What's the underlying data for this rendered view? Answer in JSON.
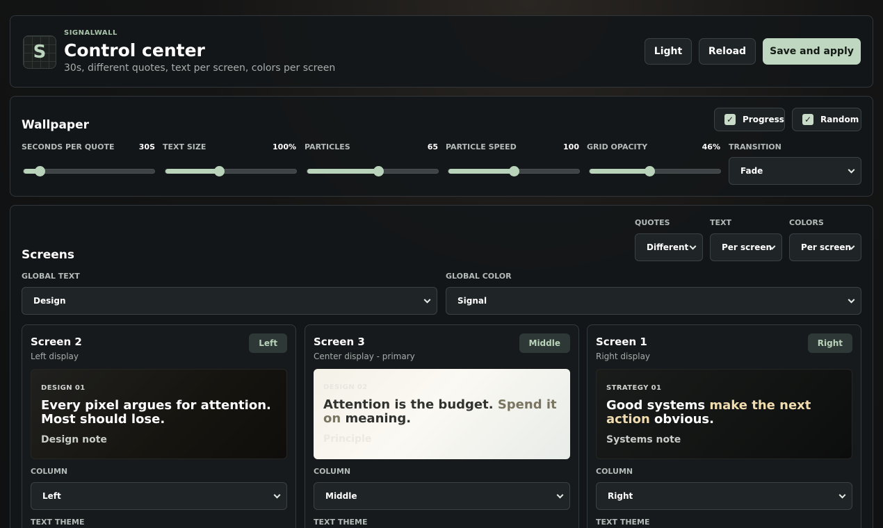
{
  "header": {
    "logo_letter": "S",
    "brand": "SIGNALWALL",
    "title": "Control center",
    "subtitle": "30s, different quotes, text per screen, colors per screen",
    "buttons": {
      "light": "Light",
      "reload": "Reload",
      "save": "Save and apply"
    }
  },
  "wallpaper": {
    "title": "Wallpaper",
    "toggles": {
      "progress": "Progress",
      "random": "Random"
    },
    "sliders": [
      {
        "label": "SECONDS PER QUOTE",
        "value_text": "30S",
        "level": 0.12
      },
      {
        "label": "TEXT SIZE",
        "value_text": "100%",
        "level": 0.41
      },
      {
        "label": "PARTICLES",
        "value_text": "65",
        "level": 0.54
      },
      {
        "label": "PARTICLE SPEED",
        "value_text": "100",
        "level": 0.5
      },
      {
        "label": "GRID OPACITY",
        "value_text": "46%",
        "level": 0.46
      }
    ],
    "transition": {
      "label": "TRANSITION",
      "value": "Fade"
    }
  },
  "screens": {
    "title": "Screens",
    "quotes": {
      "label": "QUOTES",
      "value": "Different"
    },
    "text": {
      "label": "TEXT",
      "value": "Per screen"
    },
    "colors": {
      "label": "COLORS",
      "value": "Per screen"
    },
    "global_text": {
      "label": "GLOBAL TEXT",
      "value": "Design"
    },
    "global_color": {
      "label": "GLOBAL COLOR",
      "value": "Signal"
    },
    "cards": [
      {
        "name": "Screen 2",
        "desc": "Left display",
        "badge": "Left",
        "kicker": "DESIGN 01",
        "quote": "Every pixel argues for attention. Most should lose.",
        "note": "Design note",
        "column_label": "COLUMN",
        "column_value": "Left",
        "theme_label": "TEXT THEME"
      },
      {
        "name": "Screen 3",
        "desc": "Center display - primary",
        "badge": "Middle",
        "kicker": "DESIGN 02",
        "quote_a": "Attention is the budget. ",
        "quote_b": "Spend it on",
        "quote_c": " meaning.",
        "note": "Principle",
        "column_label": "COLUMN",
        "column_value": "Middle",
        "theme_label": "TEXT THEME"
      },
      {
        "name": "Screen 1",
        "desc": "Right display",
        "badge": "Right",
        "kicker": "STRATEGY 01",
        "quote_a": "Good systems ",
        "quote_b": "make the next action",
        "quote_c": " obvious.",
        "note": "Systems note",
        "column_label": "COLUMN",
        "column_value": "Right",
        "theme_label": "TEXT THEME"
      }
    ]
  }
}
